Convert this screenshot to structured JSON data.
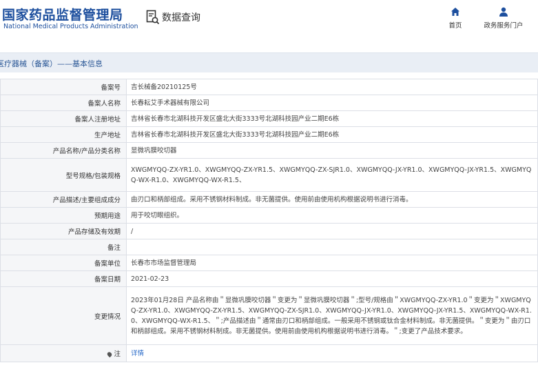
{
  "header": {
    "logo_cn": "国家药品监督管理局",
    "logo_en": "National Medical Products Administration",
    "query_icon": "search-document-icon",
    "query_label": "数据查询",
    "nav": {
      "home_icon": "home-icon",
      "home_label": "首页",
      "service_icon": "user-icon",
      "service_label": "政务服务门户"
    },
    "brand_color": "#1d4f9e"
  },
  "title_bar": {
    "text": "医疗器械（备案）——基本信息"
  },
  "rows": [
    {
      "label": "备案号",
      "value": "吉长械备20210125号"
    },
    {
      "label": "备案人名称",
      "value": "长春耘艾手术器械有限公司"
    },
    {
      "label": "备案人注册地址",
      "value": "吉林省长春市北湖科技开发区盛北大街3333号北湖科技园产业二期E6栋"
    },
    {
      "label": "生产地址",
      "value": "吉林省长春市北湖科技开发区盛北大街3333号北湖科技园产业二期E6栋"
    },
    {
      "label": "产品名称/产品分类名称",
      "value": "显微巩膜咬切器"
    },
    {
      "label": "型号规格/包装规格",
      "value": "XWGMYQQ-ZX-YR1.0、XWGMYQQ-ZX-YR1.5、XWGMYQQ-ZX-SJR1.0、XWGMYQQ-JX-YR1.0、XWGMYQQ-JX-YR1.5、XWGMYQQ-WX-R1.0、XWGMYQQ-WX-R1.5、"
    },
    {
      "label": "产品描述/主要组成成分",
      "value": "由刃口和柄部组成。采用不锈钢材料制成。非无菌提供。使用前由使用机构根据说明书进行消毒。"
    },
    {
      "label": "预期用途",
      "value": "用于咬切眼组织。"
    },
    {
      "label": "产品存储及有效期",
      "value": "/"
    },
    {
      "label": "备注",
      "value": ""
    },
    {
      "label": "备案单位",
      "value": "长春市市场监督管理局"
    },
    {
      "label": "备案日期",
      "value": "2021-02-23"
    },
    {
      "label": "变更情况",
      "value": "2023年01月28日 产品名称由＂显微巩膜咬切器＂变更为＂显微巩膜咬切器＂;型号/规格由＂XWGMYQQ-ZX-YR1.0＂变更为＂XWGMYQQ-ZX-YR1.0、XWGMYQQ-ZX-YR1.5、XWGMYQQ-ZX-SJR1.0、XWGMYQQ-JX-YR1.0、XWGMYQQ-JX-YR1.5、XWGMYQQ-WX-R1.0、XWGMYQQ-WX-R1.5、＂;产品描述由＂通常由刃口和柄部组成。一般采用不锈钢或钛合金材料制成。非无菌提供。＂变更为＂由刃口和柄部组成。采用不锈钢材料制成。非无菌提供。使用前由使用机构根据说明书进行消毒。＂;变更了产品技术要求。"
    },
    {
      "label": "注",
      "label_icon": "pin-icon",
      "value": "详情"
    }
  ]
}
